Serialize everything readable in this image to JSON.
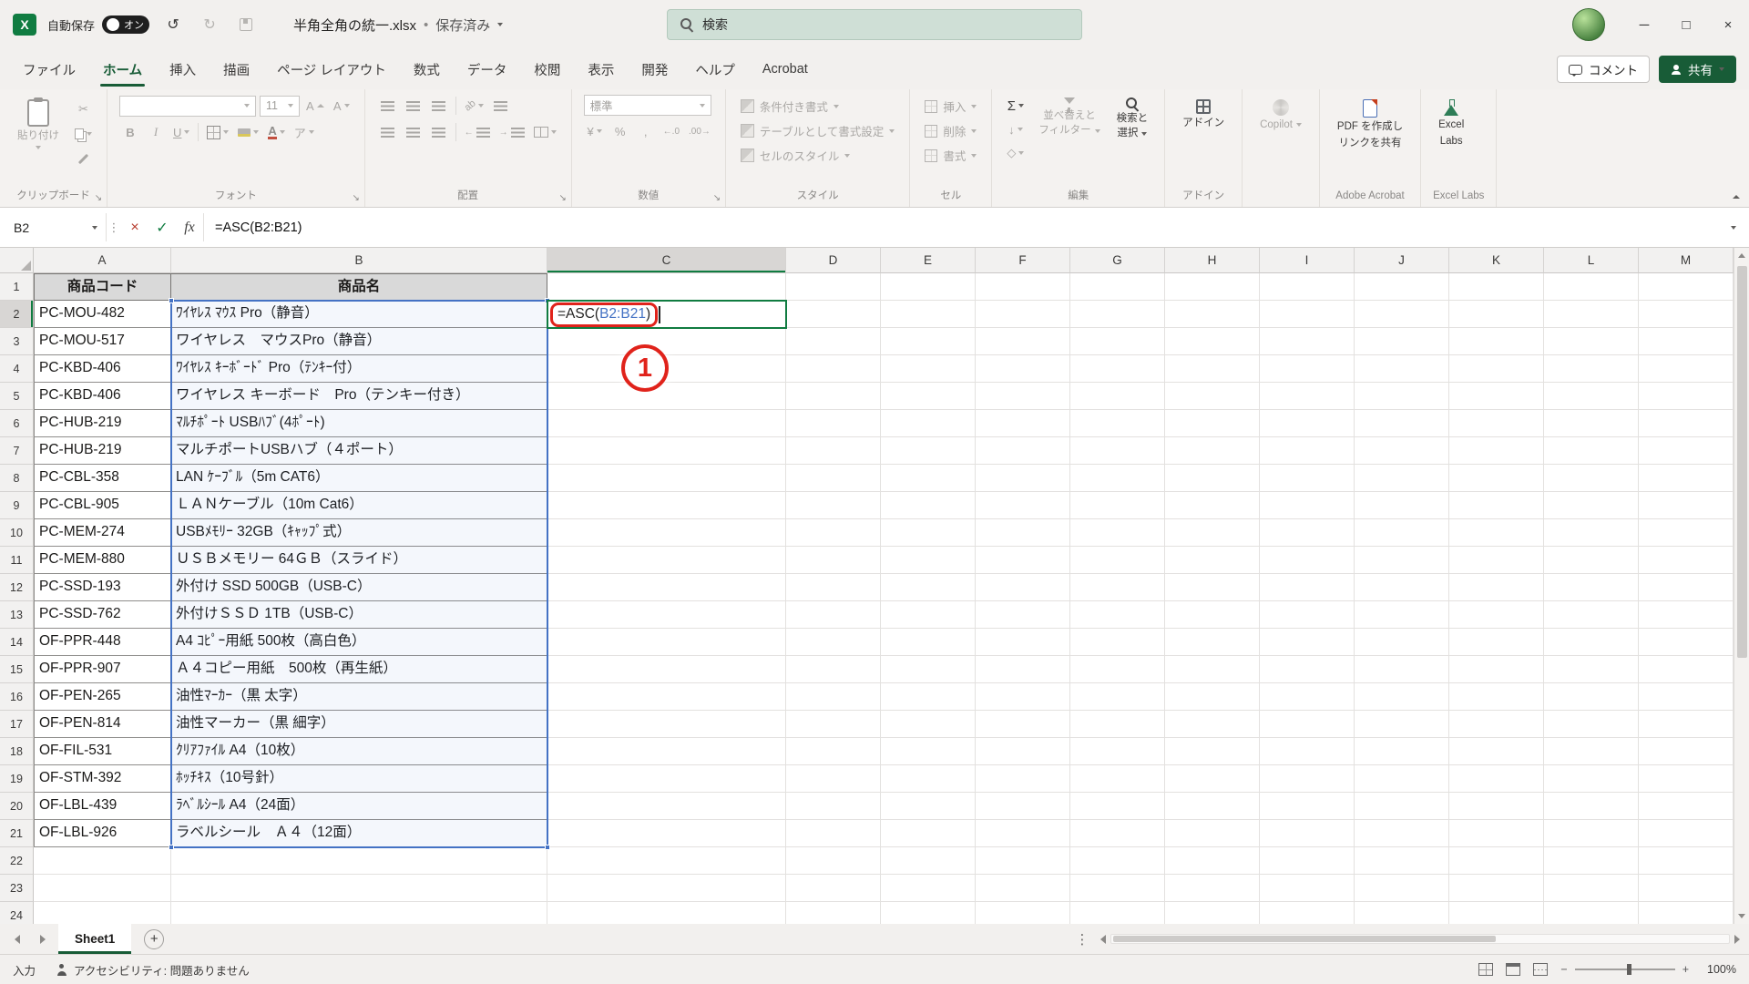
{
  "titlebar": {
    "autosave_label": "自動保存",
    "autosave_state": "オン",
    "filename": "半角全角の統一.xlsx",
    "separator": "•",
    "save_status": "保存済み",
    "search_placeholder": "検索"
  },
  "tabs": {
    "items": [
      "ファイル",
      "ホーム",
      "挿入",
      "描画",
      "ページ レイアウト",
      "数式",
      "データ",
      "校閲",
      "表示",
      "開発",
      "ヘルプ",
      "Acrobat"
    ],
    "active": "ホーム",
    "comments_label": "コメント",
    "share_label": "共有"
  },
  "ribbon": {
    "clipboard": {
      "group_label": "クリップボード",
      "paste_label": "貼り付け"
    },
    "font": {
      "group_label": "フォント",
      "font_size": "11",
      "phonetic": "ア"
    },
    "alignment": {
      "group_label": "配置"
    },
    "number": {
      "group_label": "数値",
      "format": "標準",
      "currency": "¥",
      "percent": "%",
      "comma": ",",
      "inc_decimal": "←.0",
      "dec_decimal": ".00→"
    },
    "styles": {
      "group_label": "スタイル",
      "conditional": "条件付き書式",
      "table": "テーブルとして書式設定",
      "cell_styles": "セルのスタイル"
    },
    "cells": {
      "group_label": "セル",
      "insert": "挿入",
      "delete": "削除",
      "format": "書式"
    },
    "editing": {
      "group_label": "編集",
      "autosum": "Σ",
      "sort_line1": "並べ替えと",
      "sort_line2": "フィルター",
      "find_line1": "検索と",
      "find_line2": "選択"
    },
    "addins": {
      "group_label": "アドイン",
      "addins_label": "アドイン",
      "copilot": "Copilot"
    },
    "acrobat": {
      "group_label": "Adobe Acrobat",
      "pdf_line1": "PDF を作成し",
      "pdf_line2": "リンクを共有"
    },
    "labs": {
      "group_label": "Excel Labs",
      "line1": "Excel",
      "line2": "Labs"
    }
  },
  "formula_bar": {
    "name_box": "B2",
    "cancel": "×",
    "enter": "✓",
    "fx": "fx",
    "formula": "=ASC(B2:B21)"
  },
  "grid": {
    "columns": [
      "A",
      "B",
      "C",
      "D",
      "E",
      "F",
      "G",
      "H",
      "I",
      "J",
      "K",
      "L",
      "M"
    ],
    "visible_rows": 24,
    "active_col": "C",
    "active_row": 2,
    "header_row": {
      "code": "商品コード",
      "name": "商品名"
    },
    "rows": [
      {
        "code": "PC-MOU-482",
        "name": "ﾜｲﾔﾚｽ ﾏｳｽ Pro（静音）"
      },
      {
        "code": "PC-MOU-517",
        "name": "ワイヤレス　マウスPro（静音）"
      },
      {
        "code": "PC-KBD-406",
        "name": "ﾜｲﾔﾚｽ ｷｰﾎﾞｰﾄﾞ Pro（ﾃﾝｷｰ付）"
      },
      {
        "code": "PC-KBD-406",
        "name": "ワイヤレス キーボード　Pro（テンキー付き）"
      },
      {
        "code": "PC-HUB-219",
        "name": "ﾏﾙﾁﾎﾟｰﾄ USBﾊﾌﾞ(4ﾎﾟｰﾄ)"
      },
      {
        "code": "PC-HUB-219",
        "name": "マルチポートUSBハブ（４ポート）"
      },
      {
        "code": "PC-CBL-358",
        "name": "LAN ｹｰﾌﾞﾙ（5m CAT6）"
      },
      {
        "code": "PC-CBL-905",
        "name": "ＬＡＮケーブル（10m Cat6）"
      },
      {
        "code": "PC-MEM-274",
        "name": "USBﾒﾓﾘｰ 32GB（ｷｬｯﾌﾟ式）"
      },
      {
        "code": "PC-MEM-880",
        "name": "ＵＳＢメモリー 64ＧＢ（スライド）"
      },
      {
        "code": "PC-SSD-193",
        "name": "外付け SSD 500GB（USB-C）"
      },
      {
        "code": "PC-SSD-762",
        "name": "外付けＳＳＤ 1TB（USB-C）"
      },
      {
        "code": "OF-PPR-448",
        "name": "A4 ｺﾋﾟｰ用紙 500枚（高白色）"
      },
      {
        "code": "OF-PPR-907",
        "name": "Ａ４コピー用紙　500枚（再生紙）"
      },
      {
        "code": "OF-PEN-265",
        "name": "油性ﾏｰｶｰ（黒 太字）"
      },
      {
        "code": "OF-PEN-814",
        "name": "油性マーカー（黒 細字）"
      },
      {
        "code": "OF-FIL-531",
        "name": "ｸﾘｱﾌｧｲﾙ A4（10枚）"
      },
      {
        "code": "OF-STM-392",
        "name": "ﾎｯﾁｷｽ（10号針）"
      },
      {
        "code": "OF-LBL-439",
        "name": "ﾗﾍﾞﾙｼｰﾙ A4（24面）"
      },
      {
        "code": "OF-LBL-926",
        "name": "ラベルシール　Ａ４（12面）"
      }
    ],
    "active_cell": {
      "formula_pre": "=ASC(",
      "formula_ref": "B2:B21",
      "formula_post": ")"
    }
  },
  "annotation": {
    "label": "1"
  },
  "sheet_bar": {
    "tabs": [
      "Sheet1"
    ],
    "active": "Sheet1",
    "add_label": "+"
  },
  "status_bar": {
    "mode": "入力",
    "accessibility": "アクセシビリティ: 問題ありません",
    "zoom": "100%"
  },
  "icons": {
    "app": "excel-logo",
    "search": "magnifier",
    "undo": "↺",
    "redo": "↻",
    "cut": "✂",
    "autosum": "Σ",
    "find_select": "magnifier",
    "minimize": "─",
    "maximize": "□",
    "close": "×"
  },
  "colors": {
    "excel_green": "#185C37",
    "active_cell_green": "#107c41",
    "ref_blue": "#4472c4",
    "annotation_red": "#e0231b"
  }
}
